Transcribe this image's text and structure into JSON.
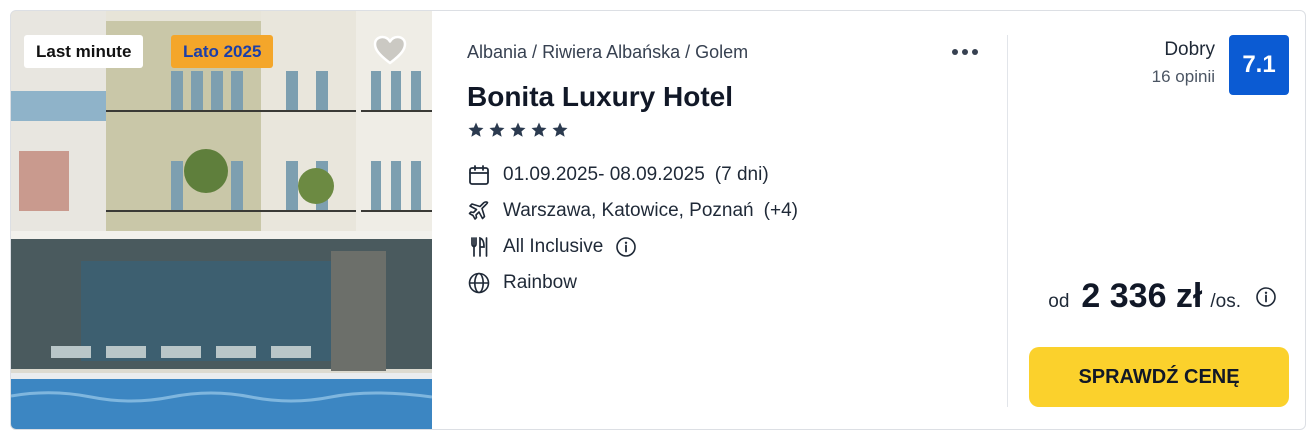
{
  "badges": {
    "last_minute": "Last minute",
    "season": "Lato 2025"
  },
  "breadcrumb": [
    "Albania",
    "Riwiera Albańska",
    "Golem"
  ],
  "breadcrumb_separator": "/",
  "hotel": {
    "name": "Bonita Luxury Hotel",
    "stars": 5
  },
  "details": {
    "dates": "01.09.2025- 08.09.2025",
    "duration": "(7 dni)",
    "departures": "Warszawa, Katowice, Poznań",
    "departures_more": "(+4)",
    "board": "All Inclusive",
    "operator": "Rainbow"
  },
  "rating": {
    "label": "Dobry",
    "reviews": "16 opinii",
    "score": "7.1"
  },
  "price": {
    "prefix": "od",
    "amount": "2 336 zł",
    "per": "/os."
  },
  "cta": {
    "label": "SPRAWDŹ CENĘ"
  },
  "icons": [
    "heart-icon",
    "more-dots-icon",
    "calendar-icon",
    "plane-icon",
    "cutlery-icon",
    "info-icon",
    "globe-icon",
    "star-icon"
  ],
  "colors": {
    "score_bg": "#0b5bd3",
    "cta_bg": "#fbd12c",
    "season_badge_bg": "#f4a62a",
    "season_badge_text": "#1c3fa8"
  }
}
